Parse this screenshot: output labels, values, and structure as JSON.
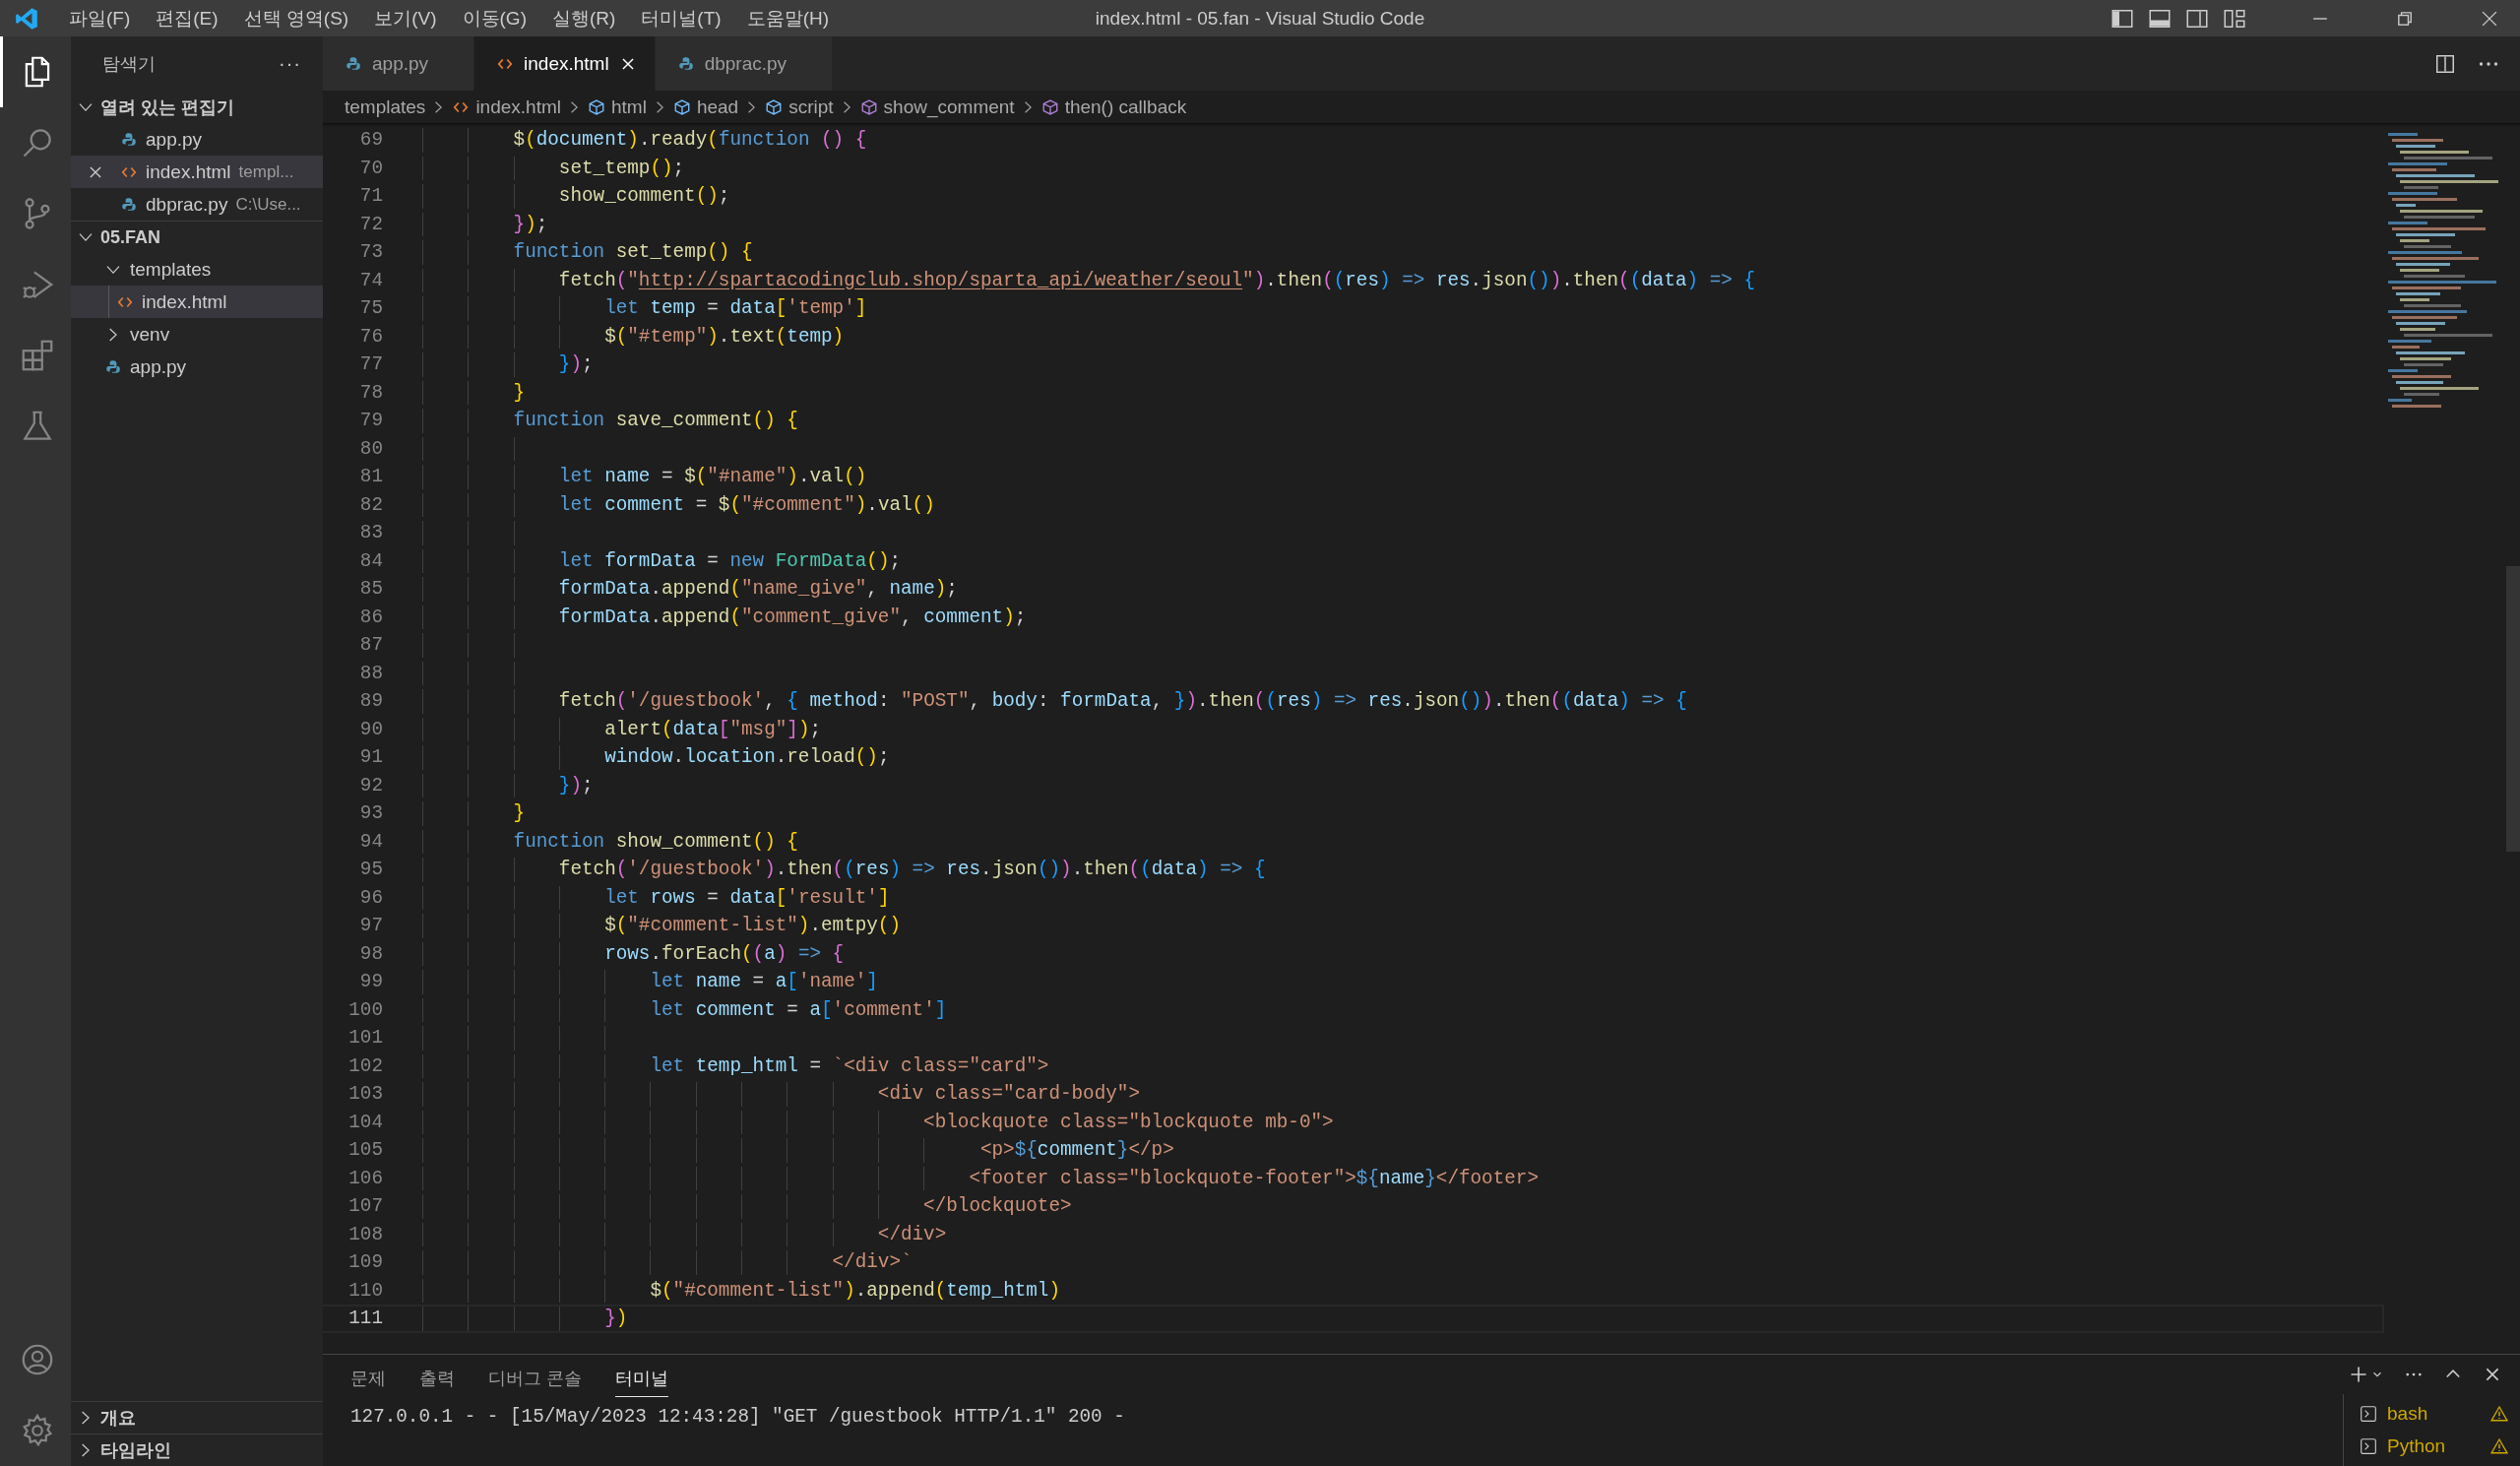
{
  "title_bar": {
    "menus": [
      "파일(F)",
      "편집(E)",
      "선택 영역(S)",
      "보기(V)",
      "이동(G)",
      "실행(R)",
      "터미널(T)",
      "도움말(H)"
    ],
    "title": "index.html - 05.fan - Visual Studio Code"
  },
  "activity_bar": {
    "top": [
      {
        "kind": "files",
        "selected": true
      },
      {
        "kind": "search",
        "selected": false
      },
      {
        "kind": "source-control",
        "selected": false
      },
      {
        "kind": "run-debug",
        "selected": false
      },
      {
        "kind": "extensions",
        "selected": false
      },
      {
        "kind": "testing",
        "selected": false
      }
    ],
    "bottom": [
      {
        "kind": "account",
        "selected": false
      },
      {
        "kind": "settings",
        "selected": false
      }
    ]
  },
  "sidebar": {
    "title": "탐색기",
    "more": "···",
    "open_editors": {
      "label": "열려 있는 편집기",
      "expanded": true,
      "items": [
        {
          "name": "app.py",
          "kind": "python",
          "selected": false
        },
        {
          "name": "index.html",
          "detail": "templ...",
          "kind": "html",
          "selected": true
        },
        {
          "name": "dbprac.py",
          "detail": "C:\\Use...",
          "kind": "python",
          "selected": false
        }
      ]
    },
    "folder": {
      "label": "05.FAN",
      "expanded": true,
      "children": [
        {
          "name": "templates",
          "kind": "folder",
          "expanded": true,
          "selected": false,
          "children": [
            {
              "name": "index.html",
              "kind": "html",
              "selected": true
            }
          ]
        },
        {
          "name": "venv",
          "kind": "folder",
          "expanded": false,
          "selected": false
        },
        {
          "name": "app.py",
          "kind": "python",
          "selected": false
        }
      ]
    },
    "sections": [
      {
        "label": "개요",
        "expanded": false
      },
      {
        "label": "타임라인",
        "expanded": false
      }
    ]
  },
  "tabs": [
    {
      "label": "app.py",
      "kind": "python",
      "selected": false
    },
    {
      "label": "index.html",
      "kind": "html",
      "selected": true
    },
    {
      "label": "dbprac.py",
      "kind": "python",
      "selected": false
    }
  ],
  "breadcrumbs": [
    {
      "label": "templates",
      "kind": "folder"
    },
    {
      "label": "index.html",
      "kind": "html"
    },
    {
      "label": "html",
      "kind": "element"
    },
    {
      "label": "head",
      "kind": "element"
    },
    {
      "label": "script",
      "kind": "element"
    },
    {
      "label": "show_comment",
      "kind": "function"
    },
    {
      "label": "then() callback",
      "kind": "function"
    }
  ],
  "editor": {
    "lines": [
      {
        "number": "69",
        "current": false,
        "tokens": [
          {
            "kind": "fn",
            "text": "        $"
          },
          {
            "kind": "br1",
            "text": "("
          },
          {
            "kind": "var",
            "text": "document"
          },
          {
            "kind": "br1",
            "text": ")"
          },
          {
            "kind": "op",
            "text": "."
          },
          {
            "kind": "fn",
            "text": "ready"
          },
          {
            "kind": "br1",
            "text": "("
          },
          {
            "kind": "kw",
            "text": "function "
          },
          {
            "kind": "br2",
            "text": "() {"
          }
        ]
      },
      {
        "number": "70",
        "current": false,
        "tokens": [
          {
            "kind": "fn",
            "text": "            set_temp"
          },
          {
            "kind": "br1",
            "text": "()"
          },
          {
            "kind": "op",
            "text": ";"
          }
        ]
      },
      {
        "number": "71",
        "current": false,
        "tokens": [
          {
            "kind": "fn",
            "text": "            show_comment"
          },
          {
            "kind": "br1",
            "text": "()"
          },
          {
            "kind": "op",
            "text": ";"
          }
        ]
      },
      {
        "number": "72",
        "current": false,
        "tokens": [
          {
            "kind": "br2",
            "text": "        }"
          },
          {
            "kind": "br1",
            "text": ")"
          },
          {
            "kind": "op",
            "text": ";"
          }
        ]
      },
      {
        "number": "73",
        "current": false,
        "tokens": [
          {
            "kind": "kw",
            "text": "        function "
          },
          {
            "kind": "fn",
            "text": "set_temp"
          },
          {
            "kind": "br1",
            "text": "() {"
          }
        ]
      },
      {
        "number": "74",
        "current": false,
        "tokens": [
          {
            "kind": "fn",
            "text": "            fetch"
          },
          {
            "kind": "br2",
            "text": "("
          },
          {
            "kind": "str",
            "text": "\""
          },
          {
            "kind": "url",
            "text": "http://spartacodingclub.shop/sparta_api/weather/seoul"
          },
          {
            "kind": "str",
            "text": "\""
          },
          {
            "kind": "br2",
            "text": ")"
          },
          {
            "kind": "op",
            "text": "."
          },
          {
            "kind": "fn",
            "text": "then"
          },
          {
            "kind": "br2",
            "text": "("
          },
          {
            "kind": "br3",
            "text": "("
          },
          {
            "kind": "var",
            "text": "res"
          },
          {
            "kind": "br3",
            "text": ")"
          },
          {
            "kind": "kw",
            "text": " => "
          },
          {
            "kind": "var",
            "text": "res"
          },
          {
            "kind": "op",
            "text": "."
          },
          {
            "kind": "fn",
            "text": "json"
          },
          {
            "kind": "br3",
            "text": "()"
          },
          {
            "kind": "br2",
            "text": ")"
          },
          {
            "kind": "op",
            "text": "."
          },
          {
            "kind": "fn",
            "text": "then"
          },
          {
            "kind": "br2",
            "text": "("
          },
          {
            "kind": "br3",
            "text": "("
          },
          {
            "kind": "var",
            "text": "data"
          },
          {
            "kind": "br3",
            "text": ")"
          },
          {
            "kind": "kw",
            "text": " => "
          },
          {
            "kind": "br3",
            "text": "{"
          }
        ]
      },
      {
        "number": "75",
        "current": false,
        "tokens": [
          {
            "kind": "kw",
            "text": "                let "
          },
          {
            "kind": "var",
            "text": "temp"
          },
          {
            "kind": "op",
            "text": " = "
          },
          {
            "kind": "var",
            "text": "data"
          },
          {
            "kind": "br1",
            "text": "["
          },
          {
            "kind": "str",
            "text": "'temp'"
          },
          {
            "kind": "br1",
            "text": "]"
          }
        ]
      },
      {
        "number": "76",
        "current": false,
        "tokens": [
          {
            "kind": "fn",
            "text": "                $"
          },
          {
            "kind": "br1",
            "text": "("
          },
          {
            "kind": "str",
            "text": "\"#temp\""
          },
          {
            "kind": "br1",
            "text": ")"
          },
          {
            "kind": "op",
            "text": "."
          },
          {
            "kind": "fn",
            "text": "text"
          },
          {
            "kind": "br1",
            "text": "("
          },
          {
            "kind": "var",
            "text": "temp"
          },
          {
            "kind": "br1",
            "text": ")"
          }
        ]
      },
      {
        "number": "77",
        "current": false,
        "tokens": [
          {
            "kind": "br3",
            "text": "            }"
          },
          {
            "kind": "br2",
            "text": ")"
          },
          {
            "kind": "op",
            "text": ";"
          }
        ]
      },
      {
        "number": "78",
        "current": false,
        "tokens": [
          {
            "kind": "br1",
            "text": "        }"
          }
        ]
      },
      {
        "number": "79",
        "current": false,
        "tokens": [
          {
            "kind": "kw",
            "text": "        function "
          },
          {
            "kind": "fn",
            "text": "save_comment"
          },
          {
            "kind": "br1",
            "text": "() {"
          }
        ]
      },
      {
        "number": "80",
        "current": false
      },
      {
        "number": "81",
        "current": false,
        "tokens": [
          {
            "kind": "kw",
            "text": "            let "
          },
          {
            "kind": "var",
            "text": "name"
          },
          {
            "kind": "op",
            "text": " = "
          },
          {
            "kind": "fn",
            "text": "$"
          },
          {
            "kind": "br1",
            "text": "("
          },
          {
            "kind": "str",
            "text": "\"#name\""
          },
          {
            "kind": "br1",
            "text": ")"
          },
          {
            "kind": "op",
            "text": "."
          },
          {
            "kind": "fn",
            "text": "val"
          },
          {
            "kind": "br1",
            "text": "()"
          }
        ]
      },
      {
        "number": "82",
        "current": false,
        "tokens": [
          {
            "kind": "kw",
            "text": "            let "
          },
          {
            "kind": "var",
            "text": "comment"
          },
          {
            "kind": "op",
            "text": " = "
          },
          {
            "kind": "fn",
            "text": "$"
          },
          {
            "kind": "br1",
            "text": "("
          },
          {
            "kind": "str",
            "text": "\"#comment\""
          },
          {
            "kind": "br1",
            "text": ")"
          },
          {
            "kind": "op",
            "text": "."
          },
          {
            "kind": "fn",
            "text": "val"
          },
          {
            "kind": "br1",
            "text": "()"
          }
        ]
      },
      {
        "number": "83",
        "current": false
      },
      {
        "number": "84",
        "current": false,
        "tokens": [
          {
            "kind": "kw",
            "text": "            let "
          },
          {
            "kind": "var",
            "text": "formData"
          },
          {
            "kind": "op",
            "text": " = "
          },
          {
            "kind": "kw",
            "text": "new "
          },
          {
            "kind": "cls",
            "text": "FormData"
          },
          {
            "kind": "br1",
            "text": "()"
          },
          {
            "kind": "op",
            "text": ";"
          }
        ]
      },
      {
        "number": "85",
        "current": false,
        "tokens": [
          {
            "kind": "var",
            "text": "            formData"
          },
          {
            "kind": "op",
            "text": "."
          },
          {
            "kind": "fn",
            "text": "append"
          },
          {
            "kind": "br1",
            "text": "("
          },
          {
            "kind": "str",
            "text": "\"name_give\""
          },
          {
            "kind": "op",
            "text": ", "
          },
          {
            "kind": "var",
            "text": "name"
          },
          {
            "kind": "br1",
            "text": ")"
          },
          {
            "kind": "op",
            "text": ";"
          }
        ]
      },
      {
        "number": "86",
        "current": false,
        "tokens": [
          {
            "kind": "var",
            "text": "            formData"
          },
          {
            "kind": "op",
            "text": "."
          },
          {
            "kind": "fn",
            "text": "append"
          },
          {
            "kind": "br1",
            "text": "("
          },
          {
            "kind": "str",
            "text": "\"comment_give\""
          },
          {
            "kind": "op",
            "text": ", "
          },
          {
            "kind": "var",
            "text": "comment"
          },
          {
            "kind": "br1",
            "text": ")"
          },
          {
            "kind": "op",
            "text": ";"
          }
        ]
      },
      {
        "number": "87",
        "current": false
      },
      {
        "number": "88",
        "current": false
      },
      {
        "number": "89",
        "current": false,
        "tokens": [
          {
            "kind": "fn",
            "text": "            fetch"
          },
          {
            "kind": "br2",
            "text": "("
          },
          {
            "kind": "str",
            "text": "'/guestbook'"
          },
          {
            "kind": "op",
            "text": ", "
          },
          {
            "kind": "br3",
            "text": "{ "
          },
          {
            "kind": "var",
            "text": "method"
          },
          {
            "kind": "op",
            "text": ": "
          },
          {
            "kind": "str",
            "text": "\"POST\""
          },
          {
            "kind": "op",
            "text": ", "
          },
          {
            "kind": "var",
            "text": "body"
          },
          {
            "kind": "op",
            "text": ": "
          },
          {
            "kind": "var",
            "text": "formData"
          },
          {
            "kind": "op",
            "text": ", "
          },
          {
            "kind": "br3",
            "text": "}"
          },
          {
            "kind": "br2",
            "text": ")"
          },
          {
            "kind": "op",
            "text": "."
          },
          {
            "kind": "fn",
            "text": "then"
          },
          {
            "kind": "br2",
            "text": "("
          },
          {
            "kind": "br3",
            "text": "("
          },
          {
            "kind": "var",
            "text": "res"
          },
          {
            "kind": "br3",
            "text": ")"
          },
          {
            "kind": "kw",
            "text": " => "
          },
          {
            "kind": "var",
            "text": "res"
          },
          {
            "kind": "op",
            "text": "."
          },
          {
            "kind": "fn",
            "text": "json"
          },
          {
            "kind": "br3",
            "text": "()"
          },
          {
            "kind": "br2",
            "text": ")"
          },
          {
            "kind": "op",
            "text": "."
          },
          {
            "kind": "fn",
            "text": "then"
          },
          {
            "kind": "br2",
            "text": "("
          },
          {
            "kind": "br3",
            "text": "("
          },
          {
            "kind": "var",
            "text": "data"
          },
          {
            "kind": "br3",
            "text": ")"
          },
          {
            "kind": "kw",
            "text": " => "
          },
          {
            "kind": "br3",
            "text": "{"
          }
        ]
      },
      {
        "number": "90",
        "current": false,
        "tokens": [
          {
            "kind": "fn",
            "text": "                alert"
          },
          {
            "kind": "br1",
            "text": "("
          },
          {
            "kind": "var",
            "text": "data"
          },
          {
            "kind": "br2",
            "text": "["
          },
          {
            "kind": "str",
            "text": "\"msg\""
          },
          {
            "kind": "br2",
            "text": "]"
          },
          {
            "kind": "br1",
            "text": ")"
          },
          {
            "kind": "op",
            "text": ";"
          }
        ]
      },
      {
        "number": "91",
        "current": false,
        "tokens": [
          {
            "kind": "var",
            "text": "                window"
          },
          {
            "kind": "op",
            "text": "."
          },
          {
            "kind": "var",
            "text": "location"
          },
          {
            "kind": "op",
            "text": "."
          },
          {
            "kind": "fn",
            "text": "reload"
          },
          {
            "kind": "br1",
            "text": "()"
          },
          {
            "kind": "op",
            "text": ";"
          }
        ]
      },
      {
        "number": "92",
        "current": false,
        "tokens": [
          {
            "kind": "br3",
            "text": "            }"
          },
          {
            "kind": "br2",
            "text": ")"
          },
          {
            "kind": "op",
            "text": ";"
          }
        ]
      },
      {
        "number": "93",
        "current": false,
        "tokens": [
          {
            "kind": "br1",
            "text": "        }"
          }
        ]
      },
      {
        "number": "94",
        "current": false,
        "tokens": [
          {
            "kind": "kw",
            "text": "        function "
          },
          {
            "kind": "fn",
            "text": "show_comment"
          },
          {
            "kind": "br1",
            "text": "() {"
          }
        ]
      },
      {
        "number": "95",
        "current": false,
        "tokens": [
          {
            "kind": "fn",
            "text": "            fetch"
          },
          {
            "kind": "br2",
            "text": "("
          },
          {
            "kind": "str",
            "text": "'/guestbook'"
          },
          {
            "kind": "br2",
            "text": ")"
          },
          {
            "kind": "op",
            "text": "."
          },
          {
            "kind": "fn",
            "text": "then"
          },
          {
            "kind": "br2",
            "text": "("
          },
          {
            "kind": "br3",
            "text": "("
          },
          {
            "kind": "var",
            "text": "res"
          },
          {
            "kind": "br3",
            "text": ")"
          },
          {
            "kind": "kw",
            "text": " => "
          },
          {
            "kind": "var",
            "text": "res"
          },
          {
            "kind": "op",
            "text": "."
          },
          {
            "kind": "fn",
            "text": "json"
          },
          {
            "kind": "br3",
            "text": "()"
          },
          {
            "kind": "br2",
            "text": ")"
          },
          {
            "kind": "op",
            "text": "."
          },
          {
            "kind": "fn",
            "text": "then"
          },
          {
            "kind": "br2",
            "text": "("
          },
          {
            "kind": "br3",
            "text": "("
          },
          {
            "kind": "var",
            "text": "data"
          },
          {
            "kind": "br3",
            "text": ")"
          },
          {
            "kind": "kw",
            "text": " => "
          },
          {
            "kind": "br3",
            "text": "{"
          }
        ]
      },
      {
        "number": "96",
        "current": false,
        "tokens": [
          {
            "kind": "kw",
            "text": "                let "
          },
          {
            "kind": "var",
            "text": "rows"
          },
          {
            "kind": "op",
            "text": " = "
          },
          {
            "kind": "var",
            "text": "data"
          },
          {
            "kind": "br1",
            "text": "["
          },
          {
            "kind": "str",
            "text": "'result'"
          },
          {
            "kind": "br1",
            "text": "]"
          }
        ]
      },
      {
        "number": "97",
        "current": false,
        "tokens": [
          {
            "kind": "fn",
            "text": "                $"
          },
          {
            "kind": "br1",
            "text": "("
          },
          {
            "kind": "str",
            "text": "\"#comment-list\""
          },
          {
            "kind": "br1",
            "text": ")"
          },
          {
            "kind": "op",
            "text": "."
          },
          {
            "kind": "fn",
            "text": "emtpy"
          },
          {
            "kind": "br1",
            "text": "()"
          }
        ]
      },
      {
        "number": "98",
        "current": false,
        "tokens": [
          {
            "kind": "var",
            "text": "                rows"
          },
          {
            "kind": "op",
            "text": "."
          },
          {
            "kind": "fn",
            "text": "forEach"
          },
          {
            "kind": "br1",
            "text": "("
          },
          {
            "kind": "br2",
            "text": "("
          },
          {
            "kind": "var",
            "text": "a"
          },
          {
            "kind": "br2",
            "text": ")"
          },
          {
            "kind": "kw",
            "text": " => "
          },
          {
            "kind": "br2",
            "text": "{"
          }
        ]
      },
      {
        "number": "99",
        "current": false,
        "tokens": [
          {
            "kind": "kw",
            "text": "                    let "
          },
          {
            "kind": "var",
            "text": "name"
          },
          {
            "kind": "op",
            "text": " = "
          },
          {
            "kind": "var",
            "text": "a"
          },
          {
            "kind": "br3",
            "text": "["
          },
          {
            "kind": "str",
            "text": "'name'"
          },
          {
            "kind": "br3",
            "text": "]"
          }
        ]
      },
      {
        "number": "100",
        "current": false,
        "tokens": [
          {
            "kind": "kw",
            "text": "                    let "
          },
          {
            "kind": "var",
            "text": "comment"
          },
          {
            "kind": "op",
            "text": " = "
          },
          {
            "kind": "var",
            "text": "a"
          },
          {
            "kind": "br3",
            "text": "["
          },
          {
            "kind": "str",
            "text": "'comment'"
          },
          {
            "kind": "br3",
            "text": "]"
          }
        ]
      },
      {
        "number": "101",
        "current": false
      },
      {
        "number": "102",
        "current": false,
        "tokens": [
          {
            "kind": "kw",
            "text": "                    let "
          },
          {
            "kind": "var",
            "text": "temp_html"
          },
          {
            "kind": "op",
            "text": " = "
          },
          {
            "kind": "str",
            "text": "`<div class=\"card\">"
          }
        ]
      },
      {
        "number": "103",
        "current": false,
        "tokens": [
          {
            "kind": "str",
            "text": "                                        <div class=\"card-body\">"
          }
        ]
      },
      {
        "number": "104",
        "current": false,
        "tokens": [
          {
            "kind": "str",
            "text": "                                            <blockquote class=\"blockquote mb-0\">"
          }
        ]
      },
      {
        "number": "105",
        "current": false,
        "tokens": [
          {
            "kind": "str",
            "text": "                                                 <p>"
          },
          {
            "kind": "kw",
            "text": "${"
          },
          {
            "kind": "var",
            "text": "comment"
          },
          {
            "kind": "kw",
            "text": "}"
          },
          {
            "kind": "str",
            "text": "</p>"
          }
        ]
      },
      {
        "number": "106",
        "current": false,
        "tokens": [
          {
            "kind": "str",
            "text": "                                                <footer class=\"blockquote-footer\">"
          },
          {
            "kind": "kw",
            "text": "${"
          },
          {
            "kind": "var",
            "text": "name"
          },
          {
            "kind": "kw",
            "text": "}"
          },
          {
            "kind": "str",
            "text": "</footer>"
          }
        ]
      },
      {
        "number": "107",
        "current": false,
        "tokens": [
          {
            "kind": "str",
            "text": "                                            </blockquote>"
          }
        ]
      },
      {
        "number": "108",
        "current": false,
        "tokens": [
          {
            "kind": "str",
            "text": "                                        </div>"
          }
        ]
      },
      {
        "number": "109",
        "current": false,
        "tokens": [
          {
            "kind": "str",
            "text": "                                    </div>`"
          }
        ]
      },
      {
        "number": "110",
        "current": false,
        "tokens": [
          {
            "kind": "fn",
            "text": "                    $"
          },
          {
            "kind": "br1",
            "text": "("
          },
          {
            "kind": "str",
            "text": "\"#comment-list\""
          },
          {
            "kind": "br1",
            "text": ")"
          },
          {
            "kind": "op",
            "text": "."
          },
          {
            "kind": "fn",
            "text": "append"
          },
          {
            "kind": "br1",
            "text": "("
          },
          {
            "kind": "var",
            "text": "temp_html"
          },
          {
            "kind": "br1",
            "text": ")"
          }
        ]
      },
      {
        "number": "111",
        "current": true,
        "tokens": [
          {
            "kind": "br2",
            "text": "                }"
          },
          {
            "kind": "br1",
            "text": ")"
          }
        ]
      }
    ]
  },
  "panel": {
    "tabs": [
      {
        "label": "문제",
        "selected": false
      },
      {
        "label": "출력",
        "selected": false
      },
      {
        "label": "디버그 콘솔",
        "selected": false
      },
      {
        "label": "터미널",
        "selected": true
      }
    ],
    "terminal_lines": [
      "127.0.0.1 - - [15/May/2023 12:43:28] \"GET /guestbook HTTP/1.1\" 200 -"
    ],
    "terminals": [
      {
        "name": "bash",
        "warning": true
      },
      {
        "name": "Python",
        "warning": true
      }
    ]
  }
}
